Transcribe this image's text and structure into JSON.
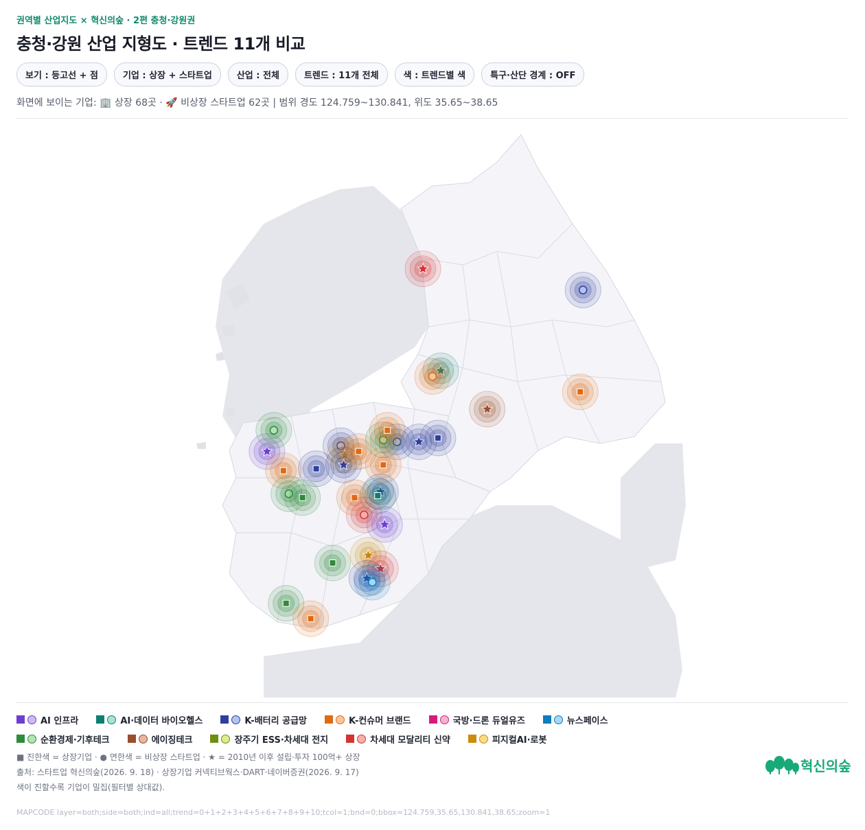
{
  "kicker": "권역별 산업지도 × 혁신의숲 · 2편 충청·강원권",
  "title": "충청·강원 산업 지형도 · 트렌드 11개 비교",
  "filters": [
    "보기 : 등고선 + 점",
    "기업 : 상장 + 스타트업",
    "산업 : 전체",
    "트렌드 : 11개 전체",
    "색 : 트렌드별 색",
    "특구·산단 경계 : OFF"
  ],
  "summary": "화면에 보이는 기업: 🏢 상장 68곳 · 🚀 비상장 스타트업 62곳  |  범위 경도 124.759~130.841, 위도 35.65~38.65",
  "legend": [
    {
      "label": "AI 인프라",
      "color": "#6d3fd1",
      "light": "#cdbaf3"
    },
    {
      "label": "AI·데이터 바이오헬스",
      "color": "#0f7f6f",
      "light": "#a8e3d6"
    },
    {
      "label": "K-배터리 공급망",
      "color": "#2f3f9e",
      "light": "#b7c2f0"
    },
    {
      "label": "K-컨슈머 브랜드",
      "color": "#e06a12",
      "light": "#f8c59d"
    },
    {
      "label": "국방·드론 듀얼유즈",
      "color": "#d81b7a",
      "light": "#f6b3d3"
    },
    {
      "label": "뉴스페이스",
      "color": "#0e7cc0",
      "light": "#a5d8f3"
    },
    {
      "label": "순환경제·기후테크",
      "color": "#2e8b3c",
      "light": "#b5e3b5"
    },
    {
      "label": "에이징테크",
      "color": "#9a4e2c",
      "light": "#e6b89e"
    },
    {
      "label": "장주기 ESS·차세대 전지",
      "color": "#6e8f10",
      "light": "#dbed8f"
    },
    {
      "label": "차세대 모달리티 신약",
      "color": "#d63232",
      "light": "#f5b0b0"
    },
    {
      "label": "피지컬AI·로봇",
      "color": "#cc8d0a",
      "light": "#f6dc8a"
    }
  ],
  "notes": {
    "marker_key": "■ 진한색 = 상장기업 · ● 연한색 = 비상장 스타트업 · ★ = 2010년 이후 설립·투자 100억+ 상장",
    "source": "출처: 스타트업 혁신의숲(2026. 9. 18) · 상장기업 커넥티브웍스·DART·네이버증권(2026. 9. 17)",
    "density": "색이 진할수록 기업이 밀집(필터별 상대값)."
  },
  "mapcode": "MAPCODE layer=both;side=both;ind=all;trend=0+1+2+3+4+5+6+7+8+9+10;tcol=1;bnd=0;bbox=124.759,35.65,130.841,38.65;zoom=1",
  "logo_text": "혁신의숲",
  "markers": [
    {
      "trend": 9,
      "kind": "star",
      "lon": 127.73,
      "lat": 37.88
    },
    {
      "trend": 2,
      "kind": "dot",
      "lon": 128.9,
      "lat": 37.77
    },
    {
      "trend": 1,
      "kind": "star",
      "lon": 127.86,
      "lat": 37.35
    },
    {
      "trend": 3,
      "kind": "dot",
      "lon": 127.8,
      "lat": 37.32
    },
    {
      "trend": 3,
      "kind": "square",
      "lon": 128.88,
      "lat": 37.24
    },
    {
      "trend": 7,
      "kind": "star",
      "lon": 128.2,
      "lat": 37.15
    },
    {
      "trend": 2,
      "kind": "star",
      "lon": 127.7,
      "lat": 36.98
    },
    {
      "trend": 2,
      "kind": "square",
      "lon": 127.84,
      "lat": 37.0
    },
    {
      "trend": 2,
      "kind": "dot",
      "lon": 127.54,
      "lat": 36.98
    },
    {
      "trend": 0,
      "kind": "star",
      "lon": 126.59,
      "lat": 36.93
    },
    {
      "trend": 6,
      "kind": "dot",
      "lon": 126.64,
      "lat": 37.04
    },
    {
      "trend": 3,
      "kind": "square",
      "lon": 126.71,
      "lat": 36.83
    },
    {
      "trend": 2,
      "kind": "square",
      "lon": 126.95,
      "lat": 36.84
    },
    {
      "trend": 6,
      "kind": "dot",
      "lon": 126.75,
      "lat": 36.71
    },
    {
      "trend": 6,
      "kind": "square",
      "lon": 126.85,
      "lat": 36.69
    },
    {
      "trend": 2,
      "kind": "dot",
      "lon": 127.13,
      "lat": 36.96
    },
    {
      "trend": 10,
      "kind": "star",
      "lon": 127.16,
      "lat": 36.91
    },
    {
      "trend": 2,
      "kind": "star",
      "lon": 127.15,
      "lat": 36.86
    },
    {
      "trend": 3,
      "kind": "square",
      "lon": 127.26,
      "lat": 36.93
    },
    {
      "trend": 6,
      "kind": "dot",
      "lon": 127.44,
      "lat": 36.99
    },
    {
      "trend": 3,
      "kind": "square",
      "lon": 127.47,
      "lat": 37.04
    },
    {
      "trend": 3,
      "kind": "square",
      "lon": 127.44,
      "lat": 36.86
    },
    {
      "trend": 2,
      "kind": "star",
      "lon": 127.42,
      "lat": 36.72
    },
    {
      "trend": 1,
      "kind": "square",
      "lon": 127.4,
      "lat": 36.7
    },
    {
      "trend": 3,
      "kind": "square",
      "lon": 127.23,
      "lat": 36.69
    },
    {
      "trend": 9,
      "kind": "dot",
      "lon": 127.3,
      "lat": 36.6
    },
    {
      "trend": 0,
      "kind": "star",
      "lon": 127.45,
      "lat": 36.55
    },
    {
      "trend": 6,
      "kind": "square",
      "lon": 127.07,
      "lat": 36.35
    },
    {
      "trend": 6,
      "kind": "square",
      "lon": 126.73,
      "lat": 36.14
    },
    {
      "trend": 3,
      "kind": "square",
      "lon": 126.91,
      "lat": 36.06
    },
    {
      "trend": 10,
      "kind": "star",
      "lon": 127.33,
      "lat": 36.39
    },
    {
      "trend": 9,
      "kind": "star",
      "lon": 127.42,
      "lat": 36.32
    },
    {
      "trend": 2,
      "kind": "star",
      "lon": 127.32,
      "lat": 36.27
    },
    {
      "trend": 5,
      "kind": "dot",
      "lon": 127.36,
      "lat": 36.25
    }
  ]
}
